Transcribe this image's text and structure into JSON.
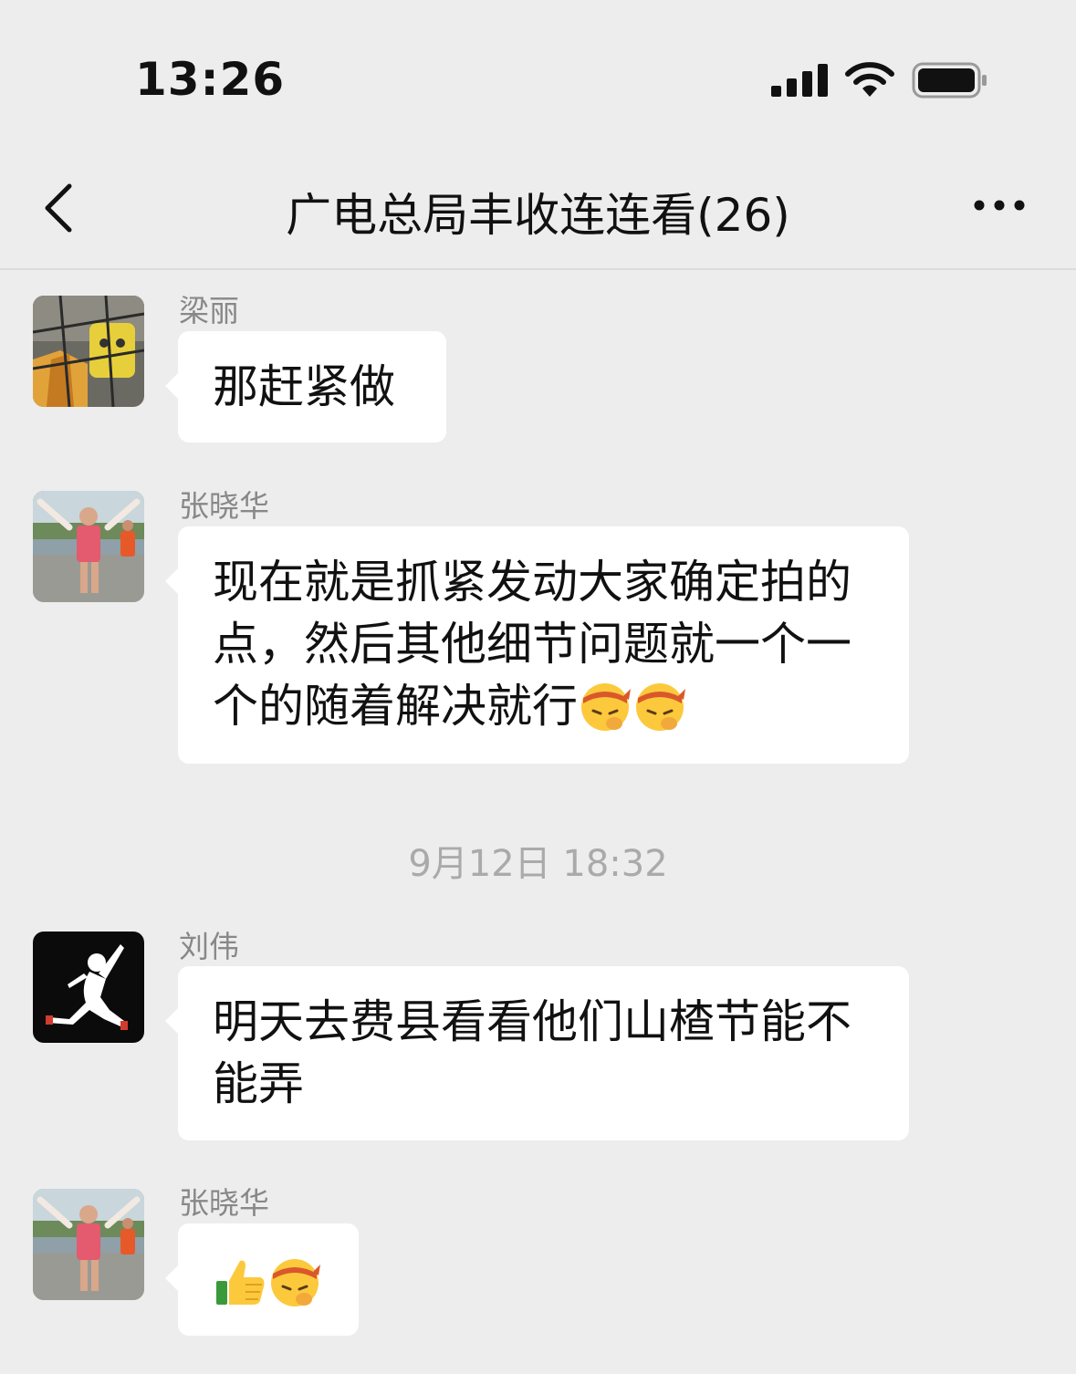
{
  "status_bar": {
    "time": "13:26",
    "icons": [
      "signal-icon",
      "wifi-icon",
      "battery-icon"
    ]
  },
  "nav": {
    "back_icon": "chevron-left-icon",
    "title": "广电总局丰收连连看(26)",
    "more_icon": "more-dots-icon"
  },
  "messages": [
    {
      "sender": "梁丽",
      "avatar": "avatar-liangli",
      "text": "那赶紧做"
    },
    {
      "sender": "张晓华",
      "avatar": "avatar-zhangxiaohua",
      "text_lines": [
        "现在就是抓紧发动大家确定拍的",
        "点，然后其他细节问题就一个一",
        "个的随着解决就行"
      ],
      "emojis": [
        "thinking-headband-emoji",
        "thinking-headband-emoji"
      ]
    },
    {
      "timestamp": "9月12日 18:32"
    },
    {
      "sender": "刘伟",
      "avatar": "avatar-liuwei",
      "text_lines": [
        "明天去费县看看他们山楂节能不",
        "能弄"
      ]
    },
    {
      "sender": "张晓华",
      "avatar": "avatar-zhangxiaohua",
      "emojis": [
        "thumbs-up-emoji",
        "thinking-headband-emoji"
      ]
    }
  ],
  "colors": {
    "background": "#ededed",
    "bubble": "#ffffff",
    "sender_name": "#888888",
    "timestamp": "#aaaaaa"
  }
}
